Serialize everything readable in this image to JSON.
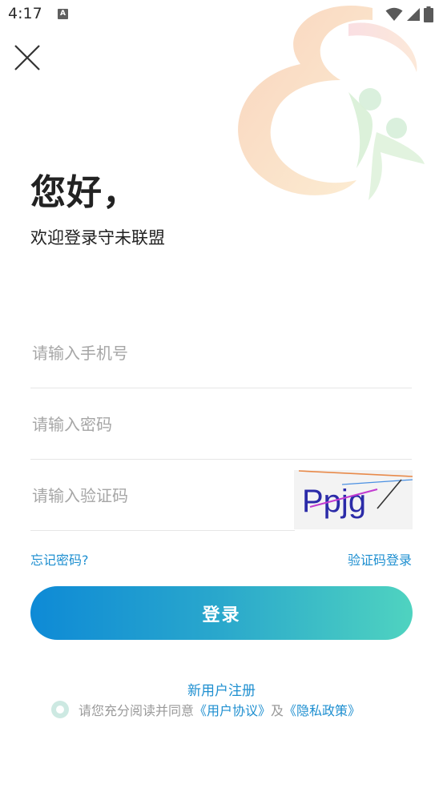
{
  "status_bar": {
    "time": "4:17",
    "notification_icon": "A"
  },
  "header": {
    "close_icon": "close-icon",
    "greeting": "您好，",
    "subtitle": "欢迎登录守未联盟"
  },
  "form": {
    "phone_placeholder": "请输入手机号",
    "password_placeholder": "请输入密码",
    "captcha_placeholder": "请输入验证码",
    "captcha_image_text": "Ppjg",
    "forgot_password": "忘记密码?",
    "sms_login": "验证码登录",
    "login_button": "登录"
  },
  "footer": {
    "register": "新用户注册",
    "agree_prefix": "请您充分阅读并同意",
    "user_agreement": "《用户协议》",
    "and": "及",
    "privacy_policy": "《隐私政策》"
  },
  "colors": {
    "accent": "#1e8fd0",
    "gradient_start": "#0e8ad6",
    "gradient_end": "#4fd3c0"
  }
}
